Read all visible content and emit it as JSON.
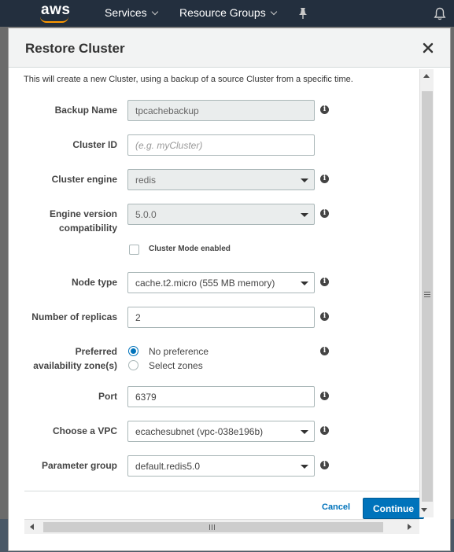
{
  "topbar": {
    "logo": "aws",
    "nav": [
      {
        "label": "Services"
      },
      {
        "label": "Resource Groups"
      }
    ],
    "icons": [
      "pin-icon",
      "bell-icon"
    ]
  },
  "modal": {
    "title": "Restore Cluster",
    "intro": "This will create a new Cluster, using a backup of a source Cluster from a specific time.",
    "fields": {
      "backup_name": {
        "label": "Backup Name",
        "value": "tpcachebackup"
      },
      "cluster_id": {
        "label": "Cluster ID",
        "placeholder": "(e.g. myCluster)"
      },
      "cluster_engine": {
        "label": "Cluster engine",
        "value": "redis"
      },
      "engine_version": {
        "label_line1": "Engine version",
        "label_line2": "compatibility",
        "value": "5.0.0"
      },
      "cluster_mode": {
        "label": "Cluster Mode enabled",
        "checked": false
      },
      "node_type": {
        "label": "Node type",
        "value": "cache.t2.micro (555 MB memory)"
      },
      "replicas": {
        "label": "Number of replicas",
        "value": "2"
      },
      "az": {
        "label_line1": "Preferred",
        "label_line2": "availability zone(s)",
        "options": [
          "No preference",
          "Select zones"
        ],
        "selected": "No preference"
      },
      "port": {
        "label": "Port",
        "value": "6379"
      },
      "vpc": {
        "label": "Choose a VPC",
        "value": "ecachesubnet (vpc-038e196b)"
      },
      "param_group": {
        "label": "Parameter group",
        "value": "default.redis5.0"
      }
    },
    "cancel_label": "Cancel",
    "continue_label": "Continue",
    "info_glyph": "i"
  },
  "colors": {
    "topbar": "#232f3e",
    "accent": "#0073bb",
    "logo_smile": "#ff9900"
  }
}
